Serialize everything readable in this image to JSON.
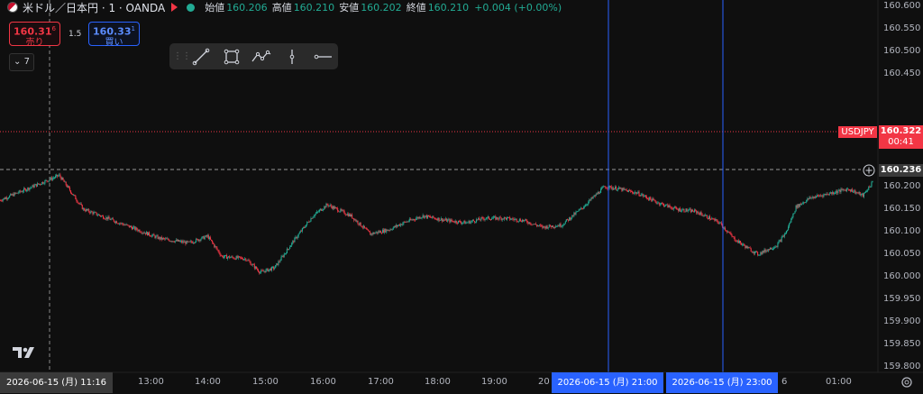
{
  "header": {
    "symbol": "米ドル／日本円 · 1 · OANDA",
    "ohlc": [
      {
        "label": "始値",
        "value": "160.206"
      },
      {
        "label": "高値",
        "value": "160.210"
      },
      {
        "label": "安値",
        "value": "160.202"
      },
      {
        "label": "終値",
        "value": "160.210"
      }
    ],
    "change": "+0.004 (+0.00%)"
  },
  "trade": {
    "sell_price": "160.31",
    "sell_sup": "6",
    "sell_label": "売り",
    "spread": "1.5",
    "buy_price": "160.33",
    "buy_sup": "1",
    "buy_label": "買い"
  },
  "indicator_count": "7",
  "drawing_tools": [
    "trend-line-icon",
    "rectangle-icon",
    "path-icon",
    "vertical-line-icon",
    "horizontal-ray-icon"
  ],
  "price_axis": {
    "ticks": [
      "160.600",
      "160.550",
      "160.500",
      "160.450",
      "160.200",
      "160.150",
      "160.100",
      "160.050",
      "160.000",
      "159.950",
      "159.900",
      "159.850",
      "159.800"
    ],
    "symbol_tag": "USDJPY",
    "last_price": "160.322",
    "countdown": "00:41",
    "crosshair_price": "160.236"
  },
  "time_axis": {
    "ticks": [
      "13:00",
      "14:00",
      "15:00",
      "16:00",
      "17:00",
      "18:00",
      "19:00",
      "20",
      "6",
      "01:00"
    ],
    "crosshair_label": "2026-06-15 (月)   11:16",
    "marker_labels": [
      "2026-06-15 (月)   21:00",
      "2026-06-15 (月)   23:00"
    ]
  },
  "colors": {
    "up": "#22ab94",
    "down": "#f23645",
    "marker": "#2962ff",
    "background": "#0f0f0f"
  },
  "chart_data": {
    "type": "candlestick",
    "ylim": [
      159.8,
      160.6
    ],
    "last_price": 160.322,
    "crosshair_price": 160.236,
    "close_path": [
      {
        "t": "10:13",
        "price": 160.17
      },
      {
        "t": "11:15",
        "price": 160.225
      },
      {
        "t": "11:40",
        "price": 160.15
      },
      {
        "t": "12:30",
        "price": 160.11
      },
      {
        "t": "13:00",
        "price": 160.085
      },
      {
        "t": "13:30",
        "price": 160.075
      },
      {
        "t": "13:50",
        "price": 160.09
      },
      {
        "t": "14:05",
        "price": 160.045
      },
      {
        "t": "14:30",
        "price": 160.04
      },
      {
        "t": "14:45",
        "price": 160.01
      },
      {
        "t": "15:00",
        "price": 160.02
      },
      {
        "t": "15:20",
        "price": 160.08
      },
      {
        "t": "15:40",
        "price": 160.135
      },
      {
        "t": "15:55",
        "price": 160.16
      },
      {
        "t": "16:20",
        "price": 160.135
      },
      {
        "t": "16:40",
        "price": 160.095
      },
      {
        "t": "17:00",
        "price": 160.105
      },
      {
        "t": "17:15",
        "price": 160.12
      },
      {
        "t": "17:35",
        "price": 160.135
      },
      {
        "t": "18:00",
        "price": 160.125
      },
      {
        "t": "18:20",
        "price": 160.12
      },
      {
        "t": "18:40",
        "price": 160.13
      },
      {
        "t": "19:00",
        "price": 160.13
      },
      {
        "t": "19:20",
        "price": 160.125
      },
      {
        "t": "19:40",
        "price": 160.11
      },
      {
        "t": "20:00",
        "price": 160.115
      },
      {
        "t": "20:20",
        "price": 160.15
      },
      {
        "t": "20:45",
        "price": 160.2
      },
      {
        "t": "21:00",
        "price": 160.195
      },
      {
        "t": "21:20",
        "price": 160.185
      },
      {
        "t": "21:40",
        "price": 160.165
      },
      {
        "t": "22:00",
        "price": 160.15
      },
      {
        "t": "22:20",
        "price": 160.145
      },
      {
        "t": "22:45",
        "price": 160.12
      },
      {
        "t": "23:00",
        "price": 160.085
      },
      {
        "t": "23:10",
        "price": 160.07
      },
      {
        "t": "23:25",
        "price": 160.05
      },
      {
        "t": "23:45",
        "price": 160.07
      },
      {
        "t": "23:55",
        "price": 160.1
      },
      {
        "t": "00:05",
        "price": 160.155
      },
      {
        "t": "00:20",
        "price": 160.175
      },
      {
        "t": "00:40",
        "price": 160.185
      },
      {
        "t": "01:00",
        "price": 160.195
      },
      {
        "t": "01:15",
        "price": 160.18
      },
      {
        "t": "01:25",
        "price": 160.21
      }
    ]
  }
}
